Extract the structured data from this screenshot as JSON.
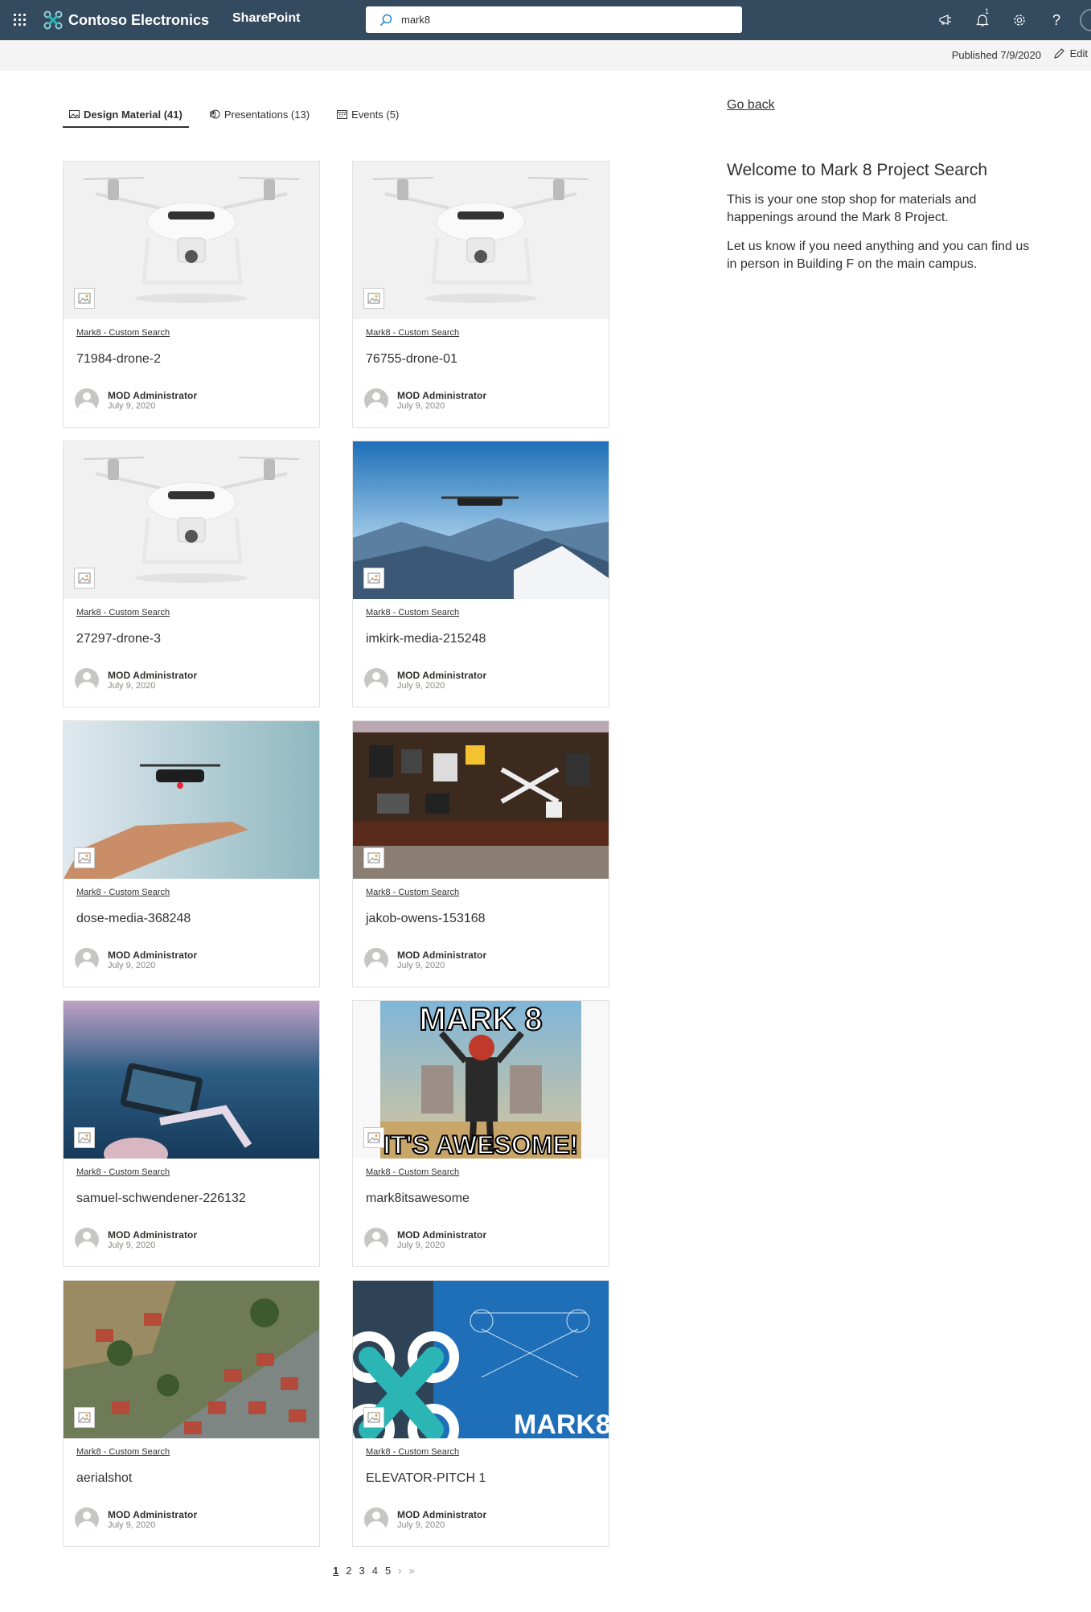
{
  "suite": {
    "brand": "Contoso Electronics",
    "app": "SharePoint",
    "search_value": "mark8",
    "notification_count": "1",
    "help": "?"
  },
  "command": {
    "published": "Published 7/9/2020",
    "edit": "Edit"
  },
  "tabs": [
    {
      "label": "Design Material (41)",
      "icon": "image-icon",
      "active": true
    },
    {
      "label": "Presentations (13)",
      "icon": "powerpoint-icon",
      "active": false
    },
    {
      "label": "Events (5)",
      "icon": "calendar-icon",
      "active": false
    }
  ],
  "results": [
    {
      "source": "Mark8 - Custom Search",
      "title": "71984-drone-2",
      "author": "MOD Administrator",
      "date": "July 9, 2020"
    },
    {
      "source": "Mark8 - Custom Search",
      "title": "76755-drone-01",
      "author": "MOD Administrator",
      "date": "July 9, 2020"
    },
    {
      "source": "Mark8 - Custom Search",
      "title": "27297-drone-3",
      "author": "MOD Administrator",
      "date": "July 9, 2020"
    },
    {
      "source": "Mark8 - Custom Search",
      "title": "imkirk-media-215248",
      "author": "MOD Administrator",
      "date": "July 9, 2020"
    },
    {
      "source": "Mark8 - Custom Search",
      "title": "dose-media-368248",
      "author": "MOD Administrator",
      "date": "July 9, 2020"
    },
    {
      "source": "Mark8 - Custom Search",
      "title": "jakob-owens-153168",
      "author": "MOD Administrator",
      "date": "July 9, 2020"
    },
    {
      "source": "Mark8 - Custom Search",
      "title": "samuel-schwendener-226132",
      "author": "MOD Administrator",
      "date": "July 9, 2020"
    },
    {
      "source": "Mark8 - Custom Search",
      "title": "mark8itsawesome",
      "author": "MOD Administrator",
      "date": "July 9, 2020",
      "meme_top": "MARK 8",
      "meme_bottom": "IT'S AWESOME!"
    },
    {
      "source": "Mark8 - Custom Search",
      "title": "aerialshot",
      "author": "MOD Administrator",
      "date": "July 9, 2020"
    },
    {
      "source": "Mark8 - Custom Search",
      "title": "ELEVATOR-PITCH 1",
      "author": "MOD Administrator",
      "date": "July 9, 2020",
      "overlay_text": "MARK8"
    }
  ],
  "pager": {
    "pages": [
      "1",
      "2",
      "3",
      "4",
      "5"
    ],
    "current": "1",
    "next": "›",
    "last": "»"
  },
  "sidebar": {
    "go_back": "Go back",
    "welcome_title": "Welcome to Mark 8 Project Search",
    "para1": "This is your one stop shop for materials and happenings around the Mark 8 Project.",
    "para2": "Let us know if you need anything and you can find us in person in Building F on the main campus."
  },
  "colors": {
    "suite_bar": "#344a5e",
    "command_bar": "#f4f4f4",
    "brand_teal": "#2bb5b5"
  }
}
